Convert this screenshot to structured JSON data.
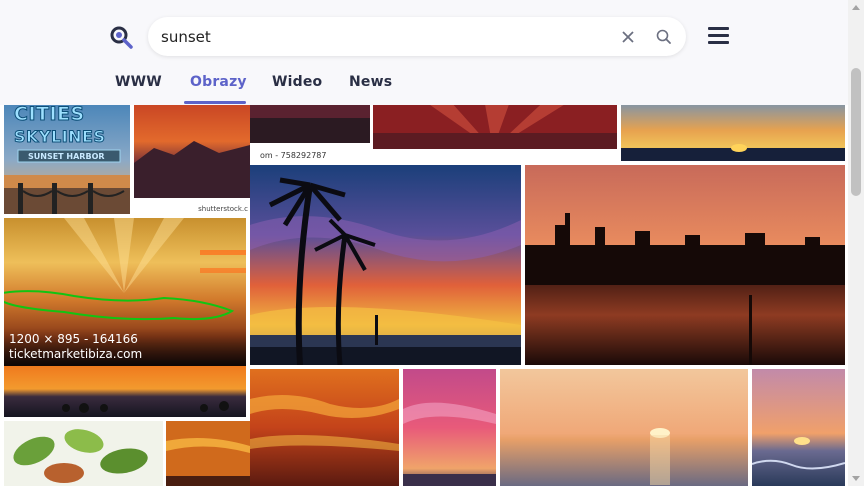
{
  "search": {
    "query": "sunset"
  },
  "tabs": [
    {
      "label": "WWW"
    },
    {
      "label": "Obrazy"
    },
    {
      "label": "Wideo"
    },
    {
      "label": "News"
    }
  ],
  "active_tab": "Obrazy",
  "colors": {
    "accent": "#5d63c9",
    "text": "#2a2f45"
  },
  "icons": [
    "search-logo-icon",
    "clear-icon",
    "search-icon",
    "hamburger-menu-icon"
  ],
  "images": {
    "cities": {
      "title": "CITIES",
      "subtitle": "SKYLINES",
      "badge": "SUNSET HARBOR"
    },
    "mountain": {
      "watermark": "shutterstock.c"
    },
    "red_sky": {
      "caption": "om - 758292787"
    },
    "hovered": {
      "dims": "1200 × 895 - 164166",
      "source": "ticketmarketibiza.com"
    }
  }
}
